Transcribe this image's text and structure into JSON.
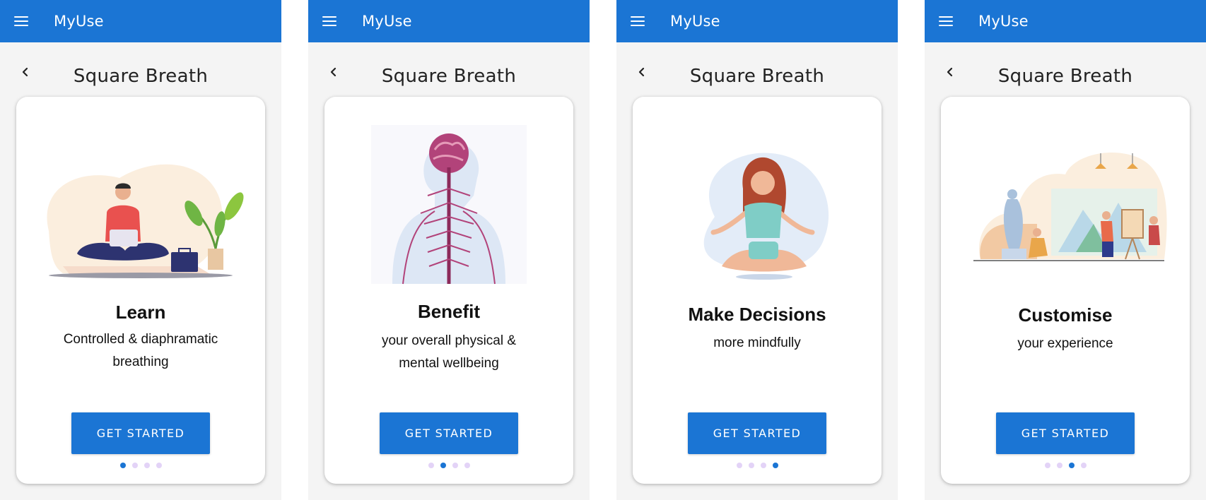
{
  "app": {
    "name": "MyUse",
    "screen_title": "Square Breath",
    "accent_color": "#1b75d4",
    "dot_inactive_color": "#e3d3f7"
  },
  "screens": [
    {
      "title": "Learn",
      "description": "Controlled & diaphramatic breathing",
      "button_label": "GET STARTED",
      "active_dot": 0,
      "illustration": "person-meditating-with-laptop-illustration"
    },
    {
      "title": "Benefit",
      "description": "your overall physical & mental wellbeing",
      "button_label": "GET STARTED",
      "active_dot": 1,
      "illustration": "nervous-system-illustration"
    },
    {
      "title": "Make Decisions",
      "description": "more mindfully",
      "button_label": "GET STARTED",
      "active_dot": 3,
      "illustration": "woman-meditating-illustration"
    },
    {
      "title": "Customise",
      "description": "your experience",
      "button_label": "GET STARTED",
      "active_dot": 2,
      "illustration": "art-studio-illustration"
    }
  ],
  "icons": {
    "menu": "hamburger-menu-icon",
    "back": "chevron-left-icon"
  }
}
